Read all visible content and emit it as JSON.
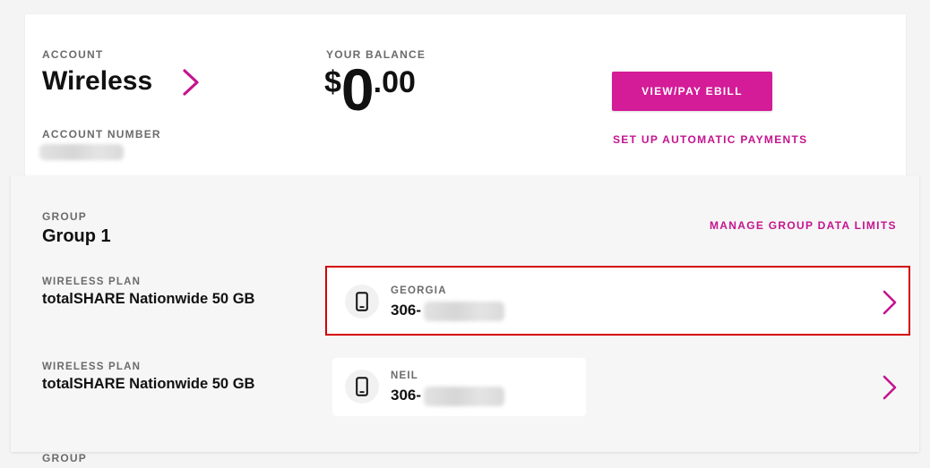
{
  "account": {
    "label": "ACCOUNT",
    "name": "Wireless",
    "number_label": "ACCOUNT NUMBER"
  },
  "balance": {
    "label": "YOUR BALANCE",
    "currency": "$",
    "whole": "0",
    "cents": ".00"
  },
  "actions": {
    "pay_button": "VIEW/PAY EBILL",
    "autopay_link": "SET UP AUTOMATIC PAYMENTS"
  },
  "group": {
    "label": "GROUP",
    "name": "Group 1",
    "manage_link": "MANAGE GROUP DATA LIMITS",
    "lines": [
      {
        "plan_label": "WIRELESS PLAN",
        "plan_name": "totalSHARE Nationwide 50 GB",
        "owner": "GEORGIA",
        "number_prefix": "306-",
        "selected": true
      },
      {
        "plan_label": "WIRELESS PLAN",
        "plan_name": "totalSHARE Nationwide 50 GB",
        "owner": "NEIL",
        "number_prefix": "306-",
        "selected": false
      }
    ]
  },
  "next_group": {
    "label": "GROUP"
  },
  "icons": {
    "chevron": "chevron-right-icon",
    "phone": "mobile-phone-icon"
  },
  "colors": {
    "accent": "#d41b98",
    "link": "#c4148f",
    "selection": "#d40000"
  }
}
